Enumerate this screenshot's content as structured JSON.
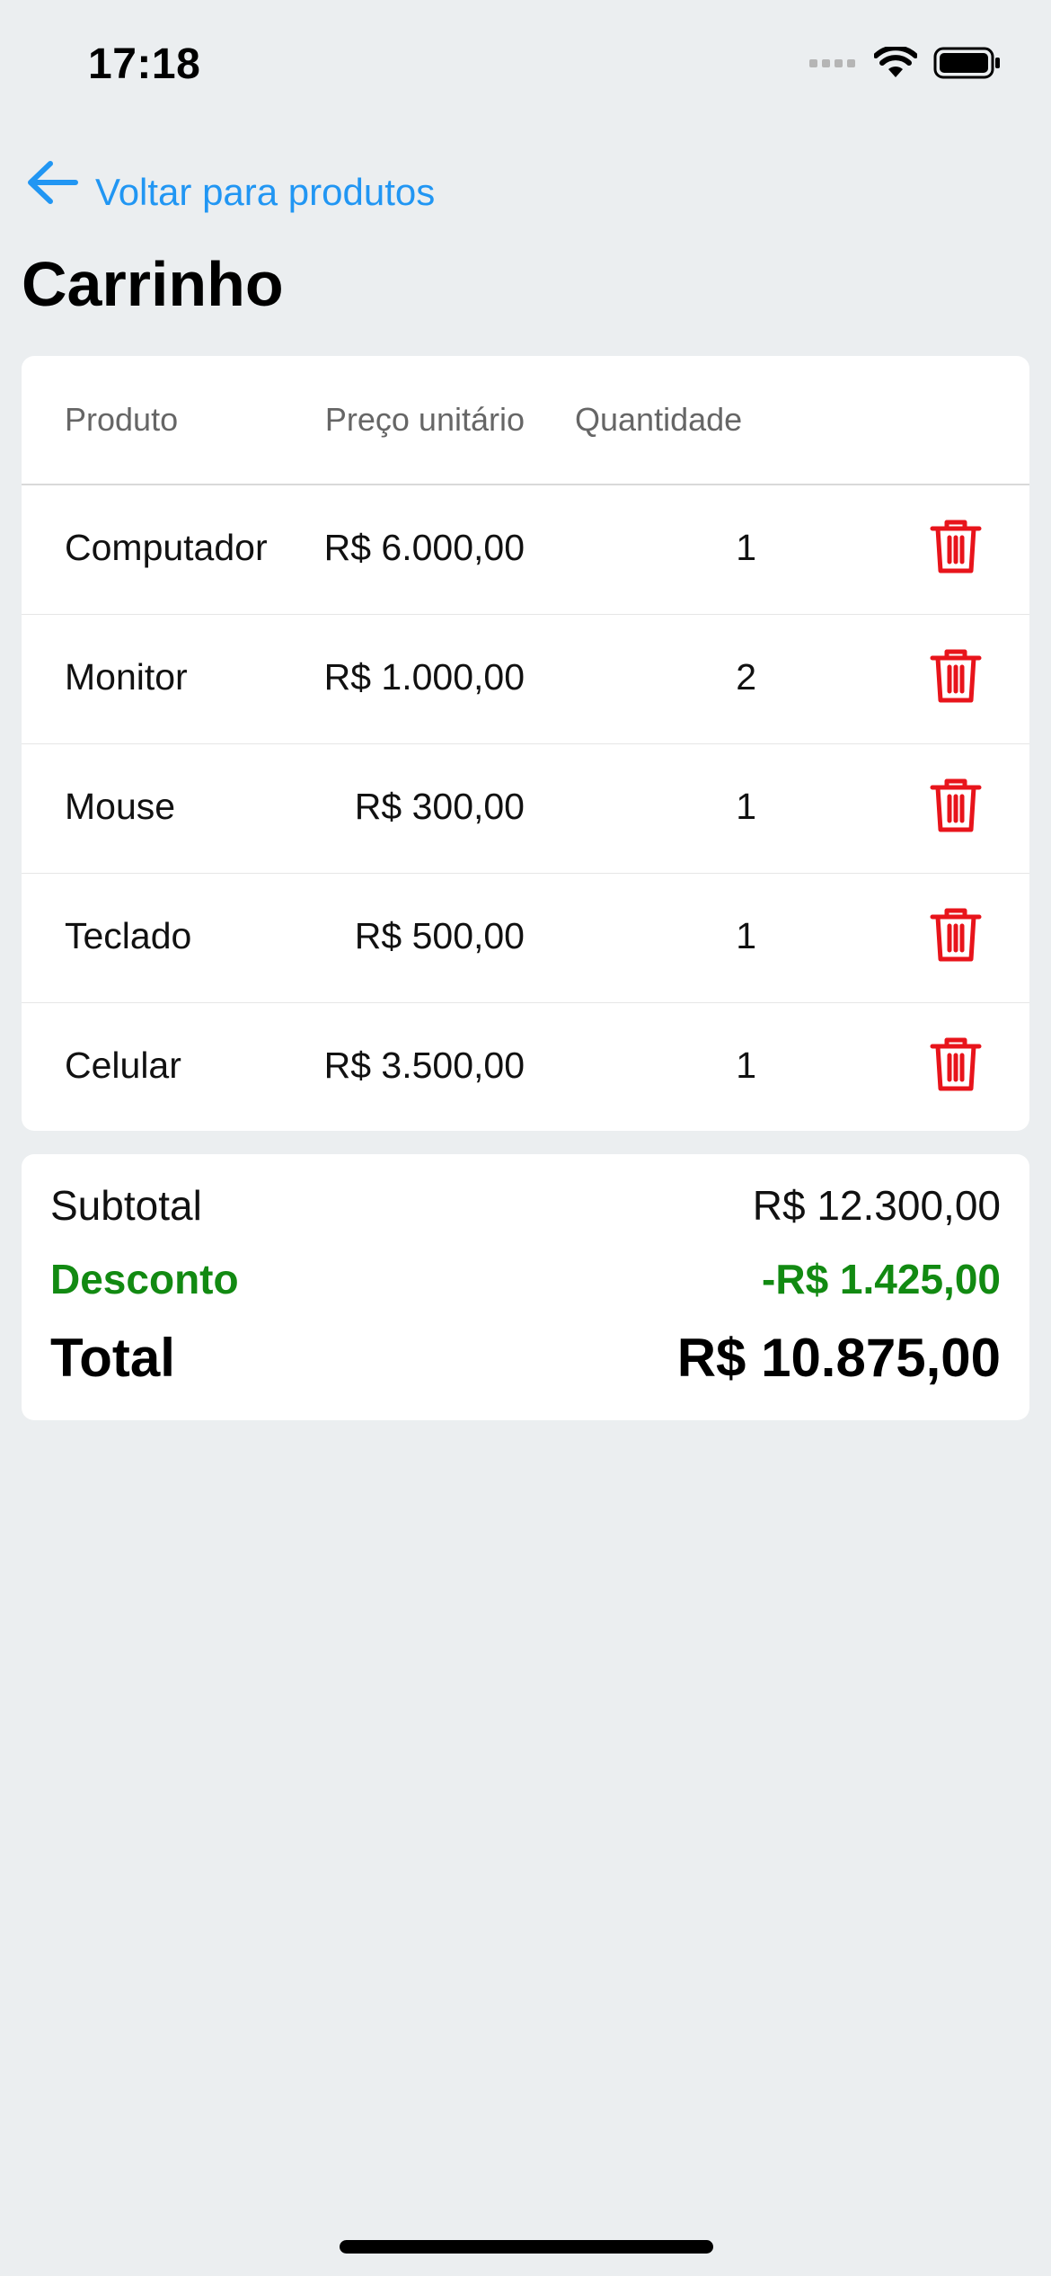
{
  "status_bar": {
    "time": "17:18",
    "icons": [
      "signal-icon",
      "wifi-icon",
      "battery-icon"
    ]
  },
  "nav": {
    "back_label": "Voltar para produtos",
    "back_icon": "arrow-left-icon"
  },
  "page": {
    "title": "Carrinho"
  },
  "table": {
    "headers": {
      "product": "Produto",
      "price": "Preço unitário",
      "quantity": "Quantidade"
    },
    "rows": [
      {
        "product": "Computador",
        "price": "R$ 6.000,00",
        "quantity": "1"
      },
      {
        "product": "Monitor",
        "price": "R$ 1.000,00",
        "quantity": "2"
      },
      {
        "product": "Mouse",
        "price": "R$ 300,00",
        "quantity": "1"
      },
      {
        "product": "Teclado",
        "price": "R$ 500,00",
        "quantity": "1"
      },
      {
        "product": "Celular",
        "price": "R$ 3.500,00",
        "quantity": "1"
      }
    ],
    "delete_icon": "trash-icon"
  },
  "summary": {
    "subtotal_label": "Subtotal",
    "subtotal_value": "R$ 12.300,00",
    "discount_label": "Desconto",
    "discount_value": "-R$ 1.425,00",
    "total_label": "Total",
    "total_value": "R$ 10.875,00"
  },
  "colors": {
    "accent": "#2196f3",
    "delete": "#e8141b",
    "discount": "#128a12",
    "background": "#ebeef0"
  }
}
